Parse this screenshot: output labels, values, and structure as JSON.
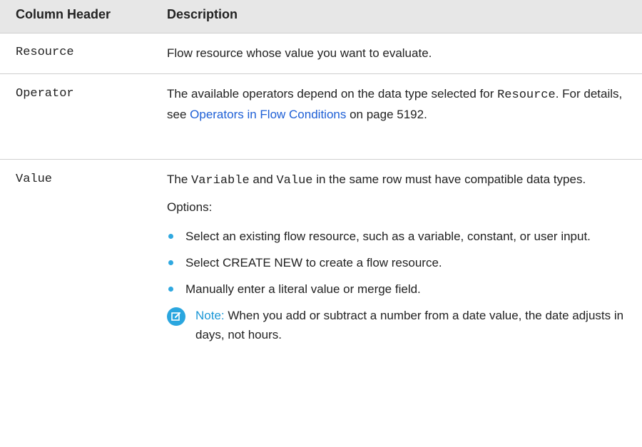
{
  "table": {
    "headers": [
      "Column Header",
      "Description"
    ],
    "rows": [
      {
        "name": "Resource",
        "desc": "Flow resource whose value you want to evaluate."
      },
      {
        "name": "Operator",
        "desc_a": "The available operators depend on the data type selected for ",
        "code": "Resource",
        "desc_b": ". For details, see ",
        "link": "Operators in Flow Conditions",
        "desc_c": " on page 5192."
      },
      {
        "name": "Value",
        "desc_a": "The ",
        "code1": "Variable",
        "desc_b": " and ",
        "code2": "Value",
        "desc_c": " in the same row must have compatible data types.",
        "options_label": "Options:",
        "bullets": [
          "Select an existing flow resource, such as a variable, constant, or user input.",
          "Select CREATE NEW to create a flow resource.",
          "Manually enter a literal value or merge field."
        ],
        "note_label": "Note:",
        "note_text": "When you add or subtract a number from a date value, the date adjusts in days, not hours.",
        "note_icon": "edit-note-icon",
        "accent_color": "#2aa6df"
      }
    ]
  }
}
